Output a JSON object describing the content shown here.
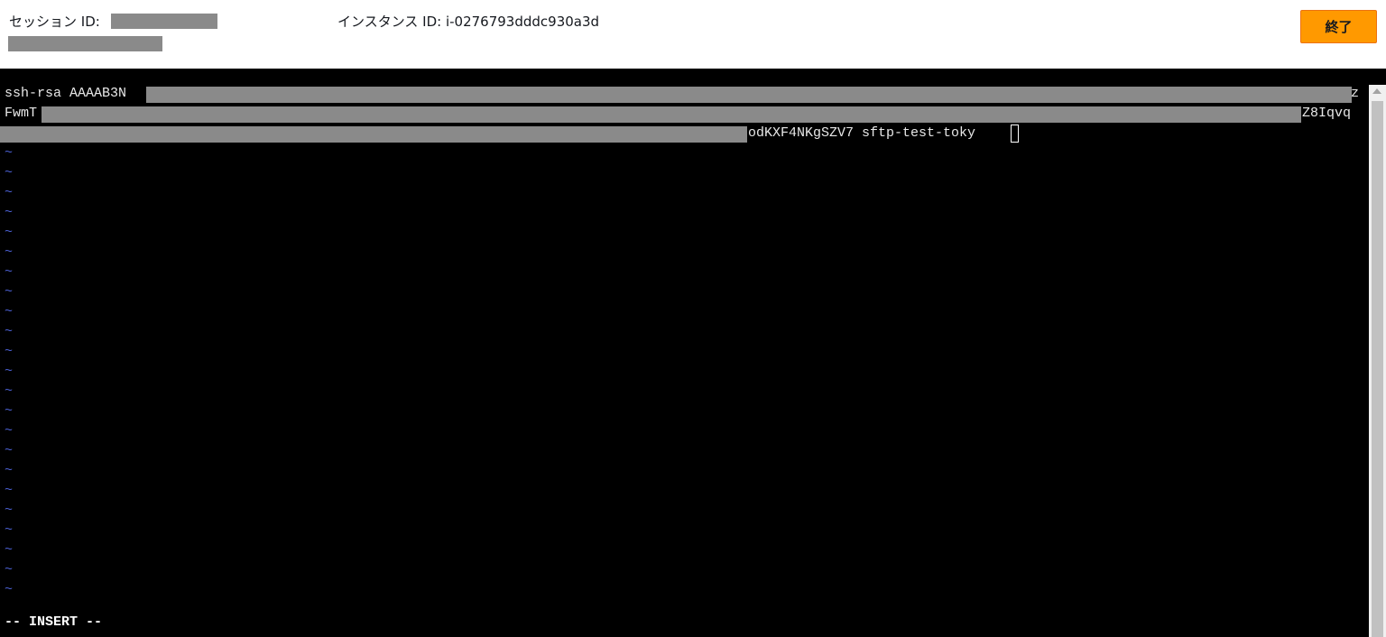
{
  "header": {
    "session_label": "セッション ID:",
    "instance_label": "インスタンス ID: i-0276793dddc930a3d",
    "terminate_label": "終了"
  },
  "terminal": {
    "line1_start": "ssh-rsa AAAAB3N",
    "line1_end": "z",
    "line2_start": "FwmT",
    "line2_end": "Z8Iqvq",
    "line3_end": "odKXF4NKgSZV7 sftp-test-toky",
    "tilde": "~",
    "mode": "-- INSERT --"
  },
  "colors": {
    "terminate_button": "#ff9900",
    "terminal_bg": "#000000",
    "tilde": "#4a5fd0"
  }
}
